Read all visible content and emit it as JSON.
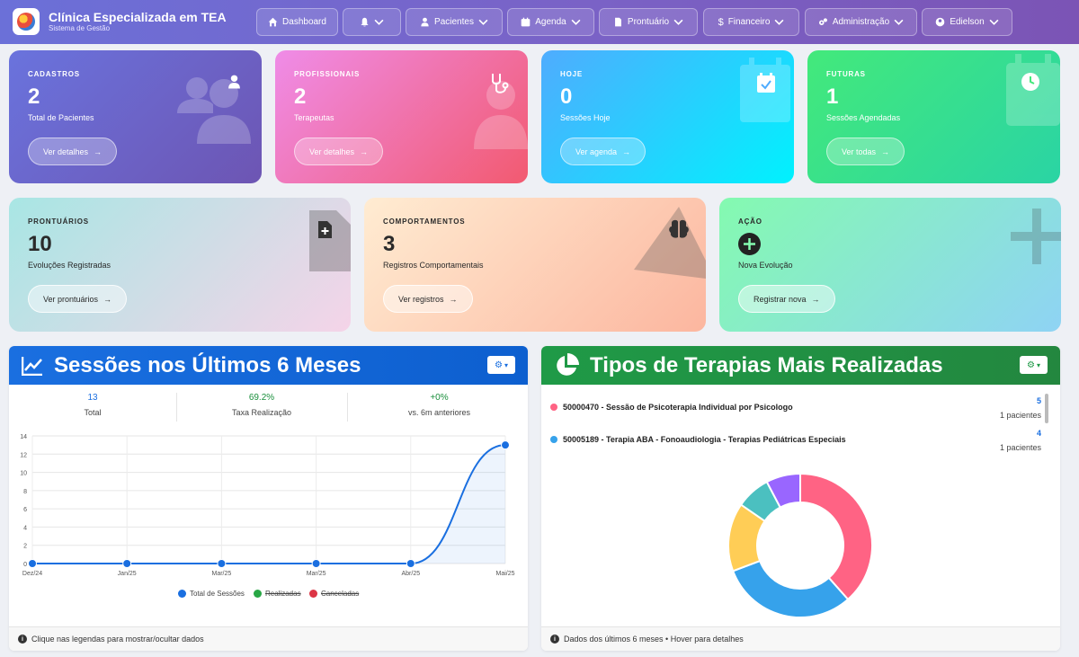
{
  "app": {
    "title": "Clínica Especializada em TEA",
    "subtitle": "Sistema de Gestão"
  },
  "nav": {
    "dashboard": "Dashboard",
    "pacientes": "Pacientes",
    "agenda": "Agenda",
    "prontuario": "Prontuário",
    "financeiro": "Financeiro",
    "administracao": "Administração",
    "user": "Edielson"
  },
  "cards": {
    "cadastros": {
      "label": "CADASTROS",
      "value": "2",
      "desc": "Total de Pacientes",
      "button": "Ver detalhes"
    },
    "profissionais": {
      "label": "PROFISSIONAIS",
      "value": "2",
      "desc": "Terapeutas",
      "button": "Ver detalhes"
    },
    "hoje": {
      "label": "HOJE",
      "value": "0",
      "desc": "Sessões Hoje",
      "button": "Ver agenda"
    },
    "futuras": {
      "label": "FUTURAS",
      "value": "1",
      "desc": "Sessões Agendadas",
      "button": "Ver todas"
    },
    "prontuarios": {
      "label": "PRONTUÁRIOS",
      "value": "10",
      "desc": "Evoluções Registradas",
      "button": "Ver prontuários"
    },
    "comportamentos": {
      "label": "COMPORTAMENTOS",
      "value": "3",
      "desc": "Registros Comportamentais",
      "button": "Ver registros"
    },
    "acao": {
      "label": "AÇÃO",
      "desc": "Nova Evolução",
      "button": "Registrar nova"
    }
  },
  "sessions_panel": {
    "title": "Sessões nos Últimos 6 Meses",
    "stats": [
      {
        "value": "13",
        "label": "Total",
        "color": "#1a6fe0"
      },
      {
        "value": "69.2%",
        "label": "Taxa Realização",
        "color": "#1a8f3c"
      },
      {
        "value": "+0%",
        "label": "vs. 6m anteriores",
        "color": "#1a8f3c"
      }
    ],
    "legend": {
      "total": "Total de Sessões",
      "realizadas": "Realizadas",
      "canceladas": "Canceladas"
    },
    "footer": "Clique nas legendas para mostrar/ocultar dados"
  },
  "therapies_panel": {
    "title": "Tipos de Terapias Mais Realizadas",
    "items": [
      {
        "name": "50000470 - Sessão de Psicoterapia Individual por Psicologo",
        "count": "5",
        "patients": "1 pacientes",
        "color": "#ff6384"
      },
      {
        "name": "50005189 - Terapia ABA - Fonoaudiologia - Terapias Pediátricas Especiais",
        "count": "4",
        "patients": "1 pacientes",
        "color": "#36a2eb"
      }
    ],
    "footer": "Dados dos últimos 6 meses • Hover para detalhes"
  },
  "chart_data": [
    {
      "type": "line",
      "x": [
        "Dez/24",
        "Jan/25",
        "Mar/25",
        "Mar/25",
        "Abr/25",
        "Mai/25"
      ],
      "series": [
        {
          "name": "Total de Sessões",
          "values": [
            0,
            0,
            0,
            0,
            0,
            13
          ],
          "color": "#1a6fe0"
        }
      ],
      "ylim": [
        0,
        14
      ],
      "yticks": [
        0,
        2,
        4,
        6,
        8,
        10,
        12,
        14
      ],
      "grid": true,
      "legend": "bottom"
    },
    {
      "type": "pie",
      "donut": true,
      "values": [
        5,
        4,
        2,
        1,
        1
      ],
      "colors": [
        "#ff6384",
        "#36a2eb",
        "#ffcd56",
        "#4bc0c0",
        "#9966ff"
      ]
    }
  ]
}
